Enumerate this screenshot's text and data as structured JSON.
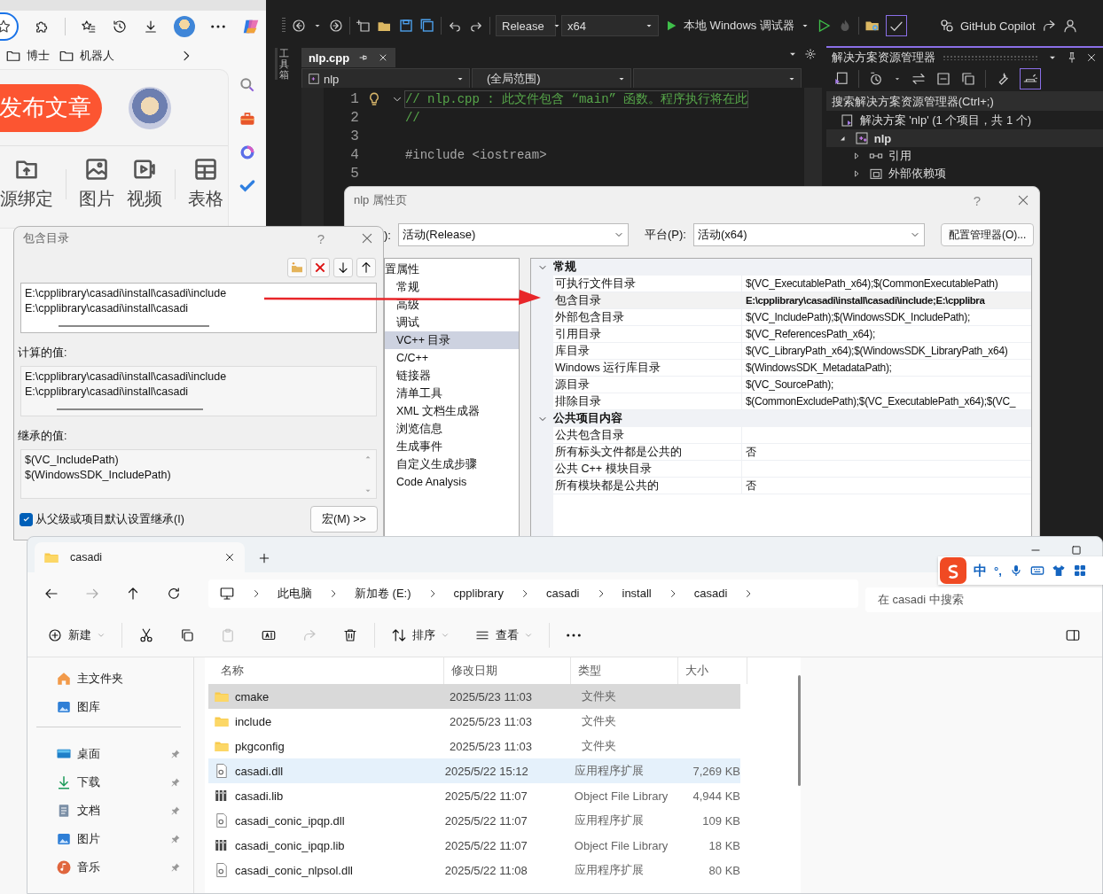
{
  "browser": {
    "bookmarks": [
      "博士",
      "机器人"
    ],
    "publish_button": "发布文章",
    "tools": [
      {
        "label": "源绑定",
        "kind": "upload"
      },
      {
        "label": "图片",
        "kind": "image"
      },
      {
        "label": "视频",
        "kind": "video"
      },
      {
        "label": "表格",
        "kind": "table"
      }
    ]
  },
  "ide": {
    "configuration": "Release",
    "platform": "x64",
    "run_target": "本地 Windows 调试器",
    "copilot": "GitHub Copilot",
    "toolbox": "工具箱",
    "editor_tab": "nlp.cpp",
    "project_dropdown": "nlp",
    "scope_dropdown": "(全局范围)",
    "code_lines": [
      {
        "number": "1",
        "kind": "comment",
        "text": "// nlp.cpp : 此文件包含 “main” 函数。程序执行将在此"
      },
      {
        "number": "2",
        "kind": "comment",
        "text": "//"
      },
      {
        "number": "3"
      },
      {
        "number": "4",
        "kind": "preprocessor",
        "text": "#include <iostream>"
      },
      {
        "number": "5"
      }
    ],
    "solution_explorer": {
      "title": "解决方案资源管理器",
      "search_placeholder": "搜索解决方案资源管理器(Ctrl+;)",
      "tree": [
        {
          "label": "解决方案 'nlp' (1 个项目，共 1 个)",
          "kind": "solution",
          "children": [
            {
              "label": "nlp",
              "kind": "project",
              "expanded": true,
              "children": [
                {
                  "label": "引用",
                  "kind": "references",
                  "expanded": false
                },
                {
                  "label": "外部依赖项",
                  "kind": "dependencies",
                  "expanded": false
                }
              ]
            }
          ]
        }
      ]
    }
  },
  "property_page": {
    "title": "nlp 属性页",
    "help": "?",
    "config_label": "):",
    "config_value": "活动(Release)",
    "platform_label": "平台(P):",
    "platform_value": "活动(x64)",
    "config_manager_button": "配置管理器(O)...",
    "tree": {
      "label": "置属性",
      "children": [
        {
          "label": "常规",
          "selected": false
        },
        {
          "label": "高级",
          "selected": false
        },
        {
          "label": "调试",
          "selected": false
        },
        {
          "label": "VC++ 目录",
          "selected": true
        },
        {
          "label": "C/C++",
          "selected": false
        },
        {
          "label": "链接器",
          "selected": false
        },
        {
          "label": "清单工具",
          "selected": false
        },
        {
          "label": "XML 文档生成器",
          "selected": false
        },
        {
          "label": "浏览信息",
          "selected": false
        },
        {
          "label": "生成事件",
          "selected": false
        },
        {
          "label": "自定义生成步骤",
          "selected": false
        },
        {
          "label": "Code Analysis",
          "selected": false
        }
      ]
    },
    "grid": [
      {
        "group": "常规",
        "expanded": true,
        "rows": [
          {
            "name": "可执行文件目录",
            "value": "$(VC_ExecutablePath_x64);$(CommonExecutablePath)",
            "modified": false,
            "selected": false
          },
          {
            "name": "包含目录",
            "value": "E:\\cpplibrary\\casadi\\install\\casadi\\include;E:\\cpplibra",
            "modified": true,
            "selected": true
          },
          {
            "name": "外部包含目录",
            "value": "$(VC_IncludePath);$(WindowsSDK_IncludePath);",
            "modified": false,
            "selected": false
          },
          {
            "name": "引用目录",
            "value": "$(VC_ReferencesPath_x64);",
            "modified": false,
            "selected": false
          },
          {
            "name": "库目录",
            "value": "$(VC_LibraryPath_x64);$(WindowsSDK_LibraryPath_x64)",
            "modified": false,
            "selected": false
          },
          {
            "name": "Windows 运行库目录",
            "value": "$(WindowsSDK_MetadataPath);",
            "modified": false,
            "selected": false
          },
          {
            "name": "源目录",
            "value": "$(VC_SourcePath);",
            "modified": false,
            "selected": false
          },
          {
            "name": "排除目录",
            "value": "$(CommonExcludePath);$(VC_ExecutablePath_x64);$(VC_",
            "modified": false,
            "selected": false
          }
        ]
      },
      {
        "group": "公共项目内容",
        "expanded": true,
        "rows": [
          {
            "name": "公共包含目录",
            "selected": false
          },
          {
            "name": "所有标头文件都是公共的",
            "value": "否",
            "modified": false,
            "selected": false
          },
          {
            "name": "公共 C++ 模块目录",
            "selected": false
          },
          {
            "name": "所有模块都是公共的",
            "value": "否",
            "modified": false,
            "selected": false
          }
        ]
      }
    ]
  },
  "include_dialog": {
    "title": "包含目录",
    "help": "?",
    "entries": [
      "E:\\cpplibrary\\casadi\\install\\casadi\\include",
      "E:\\cpplibrary\\casadi\\install\\casadi"
    ],
    "computed_label": "计算的值:",
    "computed": [
      "E:\\cpplibrary\\casadi\\install\\casadi\\include",
      "E:\\cpplibrary\\casadi\\install\\casadi"
    ],
    "inherited_label": "继承的值:",
    "inherited": [
      "$(VC_IncludePath)",
      "$(WindowsSDK_IncludePath)"
    ],
    "inherit_checkbox": {
      "label": "从父级或项目默认设置继承(I)",
      "checked": true
    },
    "macro_button": "宏(M) >>"
  },
  "explorer": {
    "tab": "casadi",
    "breadcrumb": [
      "此电脑",
      "新加卷 (E:)",
      "cpplibrary",
      "casadi",
      "install",
      "casadi"
    ],
    "search_placeholder": "在 casadi 中搜索",
    "commands": [
      {
        "kind": "new",
        "label": "新建",
        "disabled": false
      },
      {
        "kind": "cut",
        "disabled": false
      },
      {
        "kind": "copy",
        "disabled": false
      },
      {
        "kind": "paste",
        "disabled": true
      },
      {
        "kind": "rename",
        "disabled": false
      },
      {
        "kind": "share",
        "disabled": true
      },
      {
        "kind": "delete",
        "disabled": false
      },
      {
        "kind": "sort",
        "label": "排序",
        "disabled": false
      },
      {
        "kind": "view",
        "label": "查看",
        "disabled": false
      },
      {
        "kind": "more",
        "disabled": false
      }
    ],
    "sidebar_groups": [
      {
        "items": [
          {
            "label": "主文件夹",
            "kind": "home",
            "pinned": false
          },
          {
            "label": "图库",
            "kind": "gallery",
            "pinned": false
          }
        ]
      },
      {
        "items": [
          {
            "label": "桌面",
            "kind": "desktop",
            "pinned": true
          },
          {
            "label": "下载",
            "kind": "download",
            "pinned": true
          },
          {
            "label": "文档",
            "kind": "document",
            "pinned": true
          },
          {
            "label": "图片",
            "kind": "pictures",
            "pinned": true
          },
          {
            "label": "音乐",
            "kind": "music",
            "pinned": true
          }
        ]
      }
    ],
    "columns": [
      "名称",
      "修改日期",
      "类型",
      "大小"
    ],
    "files": [
      {
        "name": "cmake",
        "kind": "folder",
        "date": "2025/5/23 11:03",
        "type": "文件夹",
        "selected": true,
        "hovered": false
      },
      {
        "name": "include",
        "kind": "folder",
        "date": "2025/5/23 11:03",
        "type": "文件夹",
        "selected": false,
        "hovered": false
      },
      {
        "name": "pkgconfig",
        "kind": "folder",
        "date": "2025/5/23 11:03",
        "type": "文件夹",
        "selected": false,
        "hovered": false
      },
      {
        "name": "casadi.dll",
        "kind": "dll",
        "date": "2025/5/22 15:12",
        "type": "应用程序扩展",
        "size": "7,269 KB",
        "selected": false,
        "hovered": true
      },
      {
        "name": "casadi.lib",
        "kind": "lib",
        "date": "2025/5/22 11:07",
        "type": "Object File Library",
        "size": "4,944 KB",
        "selected": false,
        "hovered": false
      },
      {
        "name": "casadi_conic_ipqp.dll",
        "kind": "dll",
        "date": "2025/5/22 11:07",
        "type": "应用程序扩展",
        "size": "109 KB",
        "selected": false,
        "hovered": false
      },
      {
        "name": "casadi_conic_ipqp.lib",
        "kind": "lib",
        "date": "2025/5/22 11:07",
        "type": "Object File Library",
        "size": "18 KB",
        "selected": false,
        "hovered": false
      },
      {
        "name": "casadi_conic_nlpsol.dll",
        "kind": "dll",
        "date": "2025/5/22 11:08",
        "type": "应用程序扩展",
        "size": "80 KB",
        "selected": false,
        "hovered": false
      }
    ]
  },
  "ime_bar": {
    "mode": "中",
    "punctuation": "°,"
  }
}
